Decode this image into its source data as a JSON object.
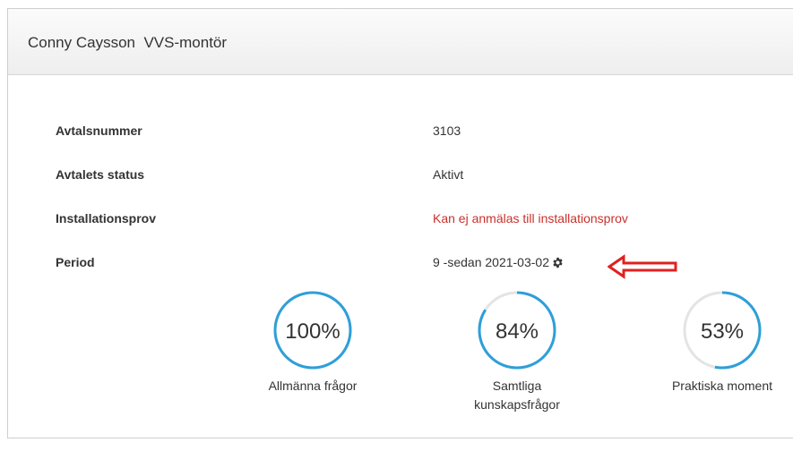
{
  "panel": {
    "title": "Conny Caysson  VVS-montör"
  },
  "info": {
    "agreement_number_label": "Avtalsnummer",
    "agreement_number_value": "3103",
    "agreement_status_label": "Avtalets status",
    "agreement_status_value": "Aktivt",
    "installation_test_label": "Installationsprov",
    "installation_test_value": "Kan ej anmälas till installationsprov",
    "period_label": "Period",
    "period_value": "9 -sedan 2021-03-02"
  },
  "stats": [
    {
      "percent_text": "100%",
      "percent": 100,
      "label": "Allmänna frågor"
    },
    {
      "percent_text": "84%",
      "percent": 84,
      "label": "Samtliga kunskapsfrågor"
    },
    {
      "percent_text": "53%",
      "percent": 53,
      "label": "Praktiska moment"
    }
  ],
  "colors": {
    "ring": "#2e9fd9",
    "warning_text": "#c9302c",
    "arrow": "#e02020"
  },
  "icons": {
    "period_settings": "gear-icon",
    "annotation": "arrow-left-icon"
  }
}
